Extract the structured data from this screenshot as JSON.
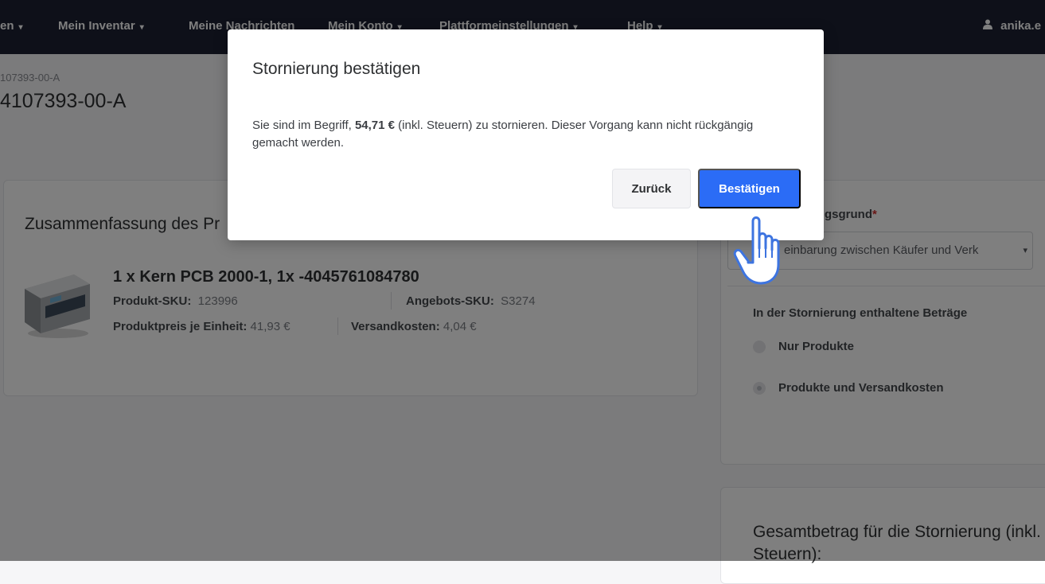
{
  "nav": {
    "items": [
      {
        "label": "en",
        "caret": "▾"
      },
      {
        "label": "Mein Inventar",
        "caret": "▾"
      },
      {
        "label": "Meine Nachrichten",
        "caret": ""
      },
      {
        "label": "Mein Konto",
        "caret": "▾"
      },
      {
        "label": "Plattformeinstellungen",
        "caret": "▾"
      },
      {
        "label": "Help",
        "caret": "▾"
      }
    ],
    "user_icon": "user-icon",
    "user": "anika.e"
  },
  "header": {
    "breadcrumb": "107393-00-A",
    "title": "4107393-00-A"
  },
  "summary": {
    "heading": "Zusammenfassung des Pr",
    "product_image": "product-image-scale",
    "product_title": "1 x Kern PCB 2000-1, 1x -4045761084780",
    "sku_label": "Produkt-SKU:",
    "sku_value": "123996",
    "offer_sku_label": "Angebots-SKU:",
    "offer_sku_value": "S3274",
    "unit_price_label": "Produktpreis je Einheit:",
    "unit_price_value": "41,93 €",
    "shipping_label": "Versandkosten:",
    "shipping_value": "4,04 €"
  },
  "reason_card": {
    "reason_label": "gsgrund",
    "required_mark": "*",
    "reason_value": "einbarung zwischen Käufer und Verk",
    "amounts_label": "In der Stornierung enthaltene Beträge",
    "options": [
      {
        "label": "Nur Produkte",
        "checked": false
      },
      {
        "label": "Produkte und Versandkosten",
        "checked": true
      }
    ]
  },
  "total_card": {
    "title": "Gesamtbetrag für die Stornierung (inkl. Steuern):"
  },
  "modal": {
    "title": "Stornierung bestätigen",
    "body_before": "Sie sind im Begriff, ",
    "amount": "54,71 €",
    "body_after": " (inkl. Steuern) zu stornieren. Dieser Vorgang kann nicht rückgängig gemacht werden.",
    "back_label": "Zurück",
    "confirm_label": "Bestätigen"
  },
  "colors": {
    "nav_bg": "#1c2133",
    "primary": "#2b6cf6",
    "required": "#d32f2f",
    "cursor_stroke": "#3d74e0"
  },
  "cursor": "pointer-hand-icon"
}
